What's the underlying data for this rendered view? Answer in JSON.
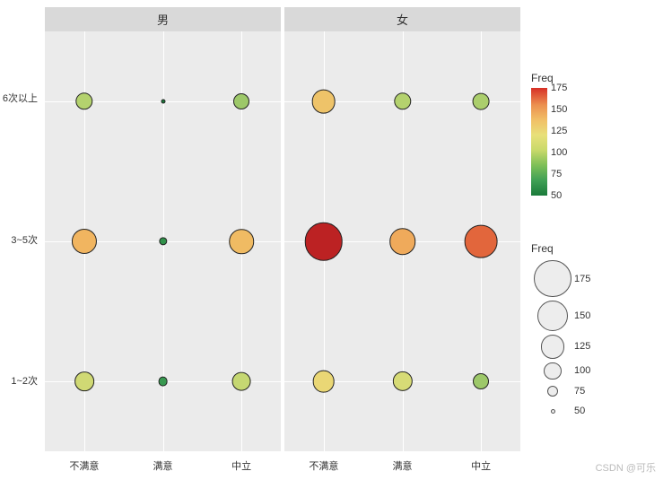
{
  "chart_data": {
    "type": "scatter",
    "facets": [
      "男",
      "女"
    ],
    "x_categories": [
      "不满意",
      "满意",
      "中立"
    ],
    "y_categories": [
      "1~2次",
      "3~5次",
      "6次以上"
    ],
    "series": [
      {
        "name": "男",
        "points": [
          {
            "x": "不满意",
            "y": "6次以上",
            "freq": 100
          },
          {
            "x": "满意",
            "y": "6次以上",
            "freq": 50
          },
          {
            "x": "中立",
            "y": "6次以上",
            "freq": 95
          },
          {
            "x": "不满意",
            "y": "3~5次",
            "freq": 130
          },
          {
            "x": "满意",
            "y": "3~5次",
            "freq": 65
          },
          {
            "x": "中立",
            "y": "3~5次",
            "freq": 128
          },
          {
            "x": "不满意",
            "y": "1~2次",
            "freq": 108
          },
          {
            "x": "满意",
            "y": "1~2次",
            "freq": 70
          },
          {
            "x": "中立",
            "y": "1~2次",
            "freq": 105
          }
        ]
      },
      {
        "name": "女",
        "points": [
          {
            "x": "不满意",
            "y": "6次以上",
            "freq": 125
          },
          {
            "x": "满意",
            "y": "6次以上",
            "freq": 100
          },
          {
            "x": "中立",
            "y": "6次以上",
            "freq": 98
          },
          {
            "x": "不满意",
            "y": "3~5次",
            "freq": 180
          },
          {
            "x": "满意",
            "y": "3~5次",
            "freq": 135
          },
          {
            "x": "中立",
            "y": "3~5次",
            "freq": 160
          },
          {
            "x": "不满意",
            "y": "1~2次",
            "freq": 118
          },
          {
            "x": "满意",
            "y": "1~2次",
            "freq": 110
          },
          {
            "x": "中立",
            "y": "1~2次",
            "freq": 95
          }
        ]
      }
    ],
    "xlabel": "",
    "ylabel": "",
    "freq_range": [
      50,
      180
    ]
  },
  "legend": {
    "color": {
      "title": "Freq",
      "ticks": [
        50,
        75,
        100,
        125,
        150,
        175
      ]
    },
    "size": {
      "title": "Freq",
      "ticks": [
        175,
        150,
        125,
        100,
        75,
        50
      ]
    }
  },
  "watermark": "CSDN @可乐"
}
